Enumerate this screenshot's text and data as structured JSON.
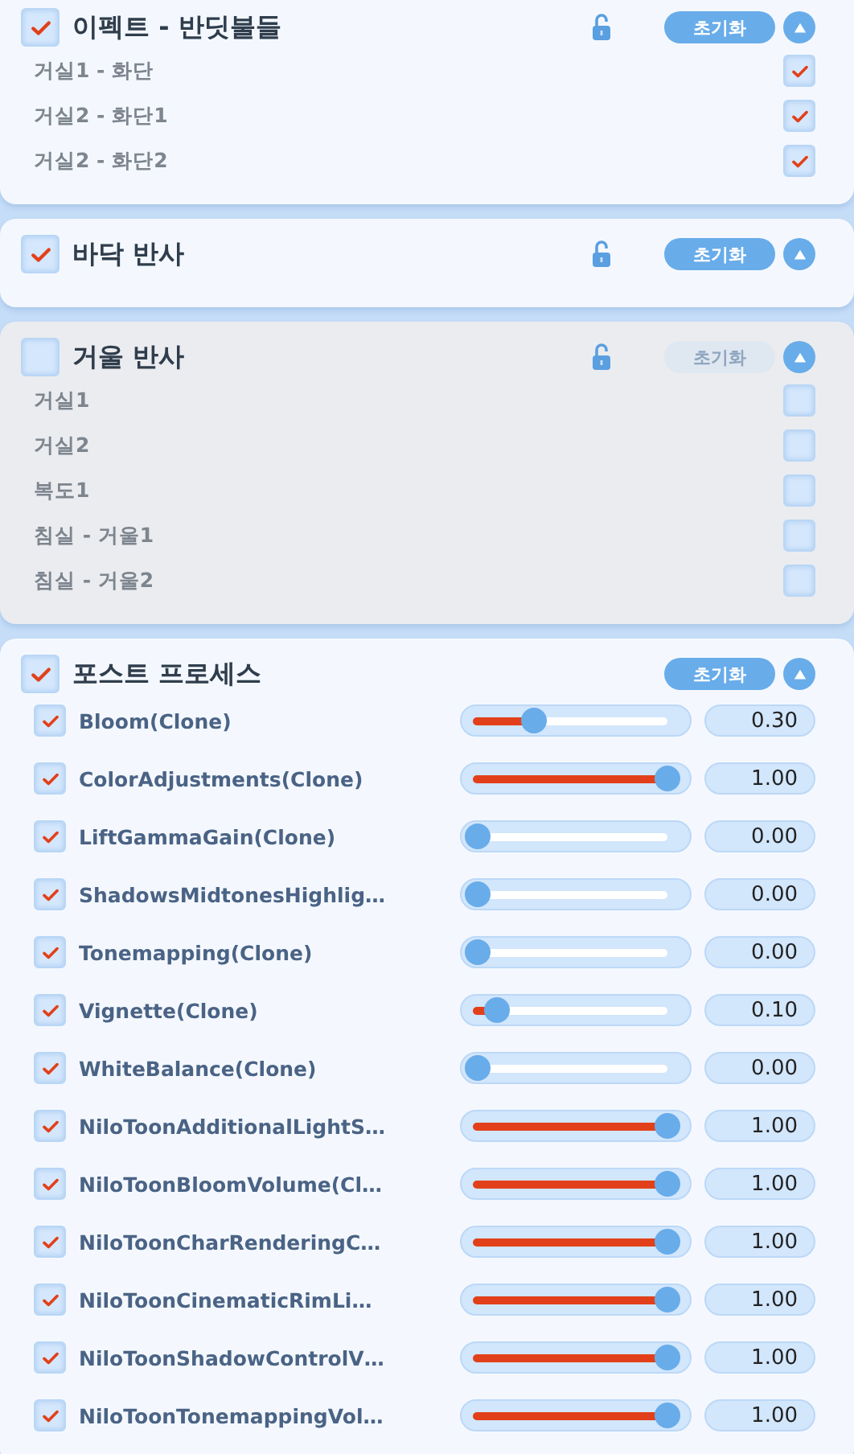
{
  "panels": [
    {
      "title": "이펙트 - 반딧불들",
      "checked": true,
      "locked": false,
      "reset_label": "초기화",
      "expanded": true,
      "items": [
        {
          "kind": "toggle",
          "label": "거실1 - 화단",
          "checked": true
        },
        {
          "kind": "toggle",
          "label": "거실2 - 화단1",
          "checked": true
        },
        {
          "kind": "toggle",
          "label": "거실2 - 화단2",
          "checked": true
        }
      ]
    },
    {
      "title": "바닥 반사",
      "checked": true,
      "locked": false,
      "reset_label": "초기화",
      "expanded": true
    },
    {
      "title": "거울 반사",
      "checked": false,
      "locked": false,
      "reset_label": "초기화",
      "expanded": true,
      "items": [
        {
          "kind": "toggle",
          "label": "거실1",
          "checked": false
        },
        {
          "kind": "toggle",
          "label": "거실2",
          "checked": false
        },
        {
          "kind": "toggle",
          "label": "복도1",
          "checked": false
        },
        {
          "kind": "toggle",
          "label": "침실 - 거울1",
          "checked": false
        },
        {
          "kind": "toggle",
          "label": "침실 - 거울2",
          "checked": false
        }
      ]
    },
    {
      "title": "포스트 프로세스",
      "checked": true,
      "reset_label": "초기화",
      "expanded": true,
      "items": [
        {
          "kind": "slider",
          "label": "Bloom(Clone)",
          "checked": true,
          "level": 0.3,
          "reading": "0.30"
        },
        {
          "kind": "slider",
          "label": "ColorAdjustments(Clone)",
          "checked": true,
          "level": 1,
          "reading": "1.00"
        },
        {
          "kind": "slider",
          "label": "LiftGammaGain(Clone)",
          "checked": true,
          "level": 0,
          "reading": "0.00"
        },
        {
          "kind": "slider",
          "label": "ShadowsMidtonesHighlig…",
          "checked": true,
          "level": 0,
          "reading": "0.00"
        },
        {
          "kind": "slider",
          "label": "Tonemapping(Clone)",
          "checked": true,
          "level": 0,
          "reading": "0.00"
        },
        {
          "kind": "slider",
          "label": "Vignette(Clone)",
          "checked": true,
          "level": 0.1,
          "reading": "0.10"
        },
        {
          "kind": "slider",
          "label": "WhiteBalance(Clone)",
          "checked": true,
          "level": 0,
          "reading": "0.00"
        },
        {
          "kind": "slider",
          "label": "NiloToonAdditionalLightS…",
          "checked": true,
          "level": 1,
          "reading": "1.00"
        },
        {
          "kind": "slider",
          "label": "NiloToonBloomVolume(Cl…",
          "checked": true,
          "level": 1,
          "reading": "1.00"
        },
        {
          "kind": "slider",
          "label": "NiloToonCharRenderingC…",
          "checked": true,
          "level": 1,
          "reading": "1.00"
        },
        {
          "kind": "slider",
          "label": "NiloToonCinematicRimLi…",
          "checked": true,
          "level": 1,
          "reading": "1.00"
        },
        {
          "kind": "slider",
          "label": "NiloToonShadowControlV…",
          "checked": true,
          "level": 1,
          "reading": "1.00"
        },
        {
          "kind": "slider",
          "label": "NiloToonTonemappingVol…",
          "checked": true,
          "level": 1,
          "reading": "1.00"
        }
      ]
    }
  ]
}
